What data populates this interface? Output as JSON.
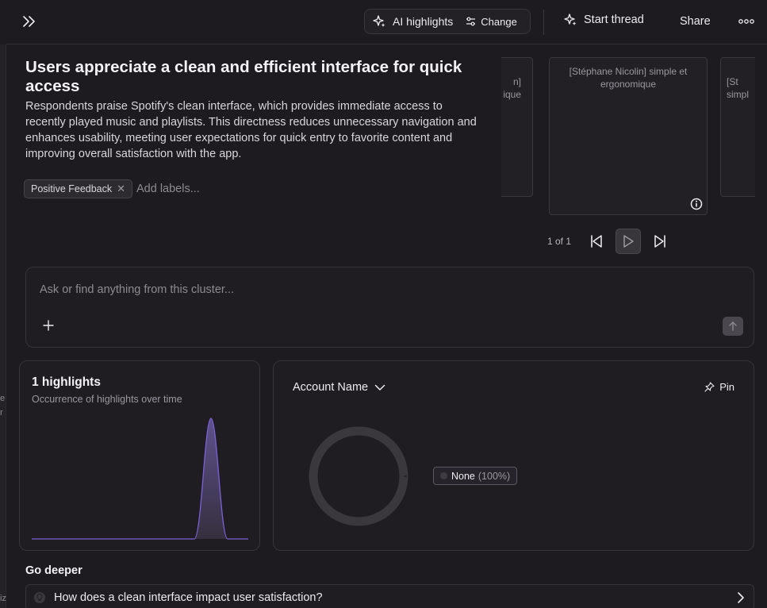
{
  "toolbar": {
    "ai_highlights_label": "AI highlights",
    "change_label": "Change",
    "start_thread_label": "Start thread",
    "share_label": "Share"
  },
  "cluster": {
    "title": "Users appreciate a clean and efficient interface for quick access",
    "description": "Respondents praise Spotify's clean interface, which provides immediate access to recently played music and playlists. This directness reduces unnecessary navigation and enhances usability, meeting user expectations for quick entry to favorite content and improving overall satisfaction with the app.",
    "labels": [
      "Positive Feedback"
    ],
    "add_labels_placeholder": "Add labels..."
  },
  "carousel": {
    "left_card_text": "n]\nique",
    "center_card_text": "[Stéphane Nicolin] simple et ergonomique",
    "right_card_text": "[St\nsimpl",
    "pager": "1 of 1"
  },
  "ask": {
    "placeholder": "Ask or find anything from this cluster..."
  },
  "highlights_panel": {
    "count_label": "1 highlights",
    "subtitle": "Occurrence of highlights over time",
    "line_color": "#7b61d6"
  },
  "account_panel": {
    "dropdown_label": "Account Name",
    "pin_label": "Pin",
    "legend": [
      {
        "name": "None",
        "percent": "(100%)"
      }
    ],
    "donut_color": "#3a383d"
  },
  "go_deeper": {
    "heading": "Go deeper",
    "questions": [
      "How does a clean interface impact user satisfaction?"
    ]
  },
  "sidebar_fragments": [
    "e",
    "r",
    "iz"
  ]
}
